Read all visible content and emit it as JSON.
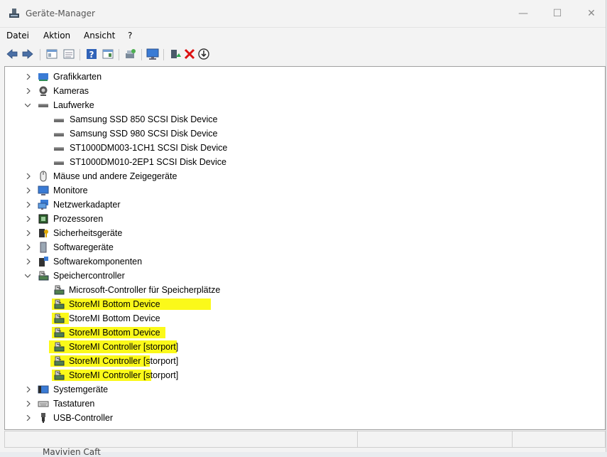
{
  "window": {
    "title": "Geräte-Manager",
    "controls": {
      "minimize": "—",
      "maximize": "☐",
      "close": "✕"
    }
  },
  "menu": [
    "Datei",
    "Aktion",
    "Ansicht",
    "?"
  ],
  "toolbar_icons": [
    "back-arrow-icon",
    "forward-arrow-icon",
    "show-hide-console-tree-icon",
    "properties-icon",
    "help-icon",
    "action-pane-icon",
    "scan-hardware-icon",
    "monitor-icon",
    "update-driver-icon",
    "uninstall-icon",
    "disable-device-icon"
  ],
  "tree": {
    "grafikkarten": "Grafikkarten",
    "kameras": "Kameras",
    "laufwerke": "Laufwerke",
    "laufwerke_children": [
      "Samsung SSD 850 SCSI Disk Device",
      "Samsung SSD 980 SCSI Disk Device",
      "ST1000DM003-1CH1 SCSI Disk Device",
      "ST1000DM010-2EP1 SCSI Disk Device"
    ],
    "maeuse": "Mäuse und andere Zeigegeräte",
    "monitore": "Monitore",
    "netzwerkadapter": "Netzwerkadapter",
    "prozessoren": "Prozessoren",
    "sicherheitsgeraete": "Sicherheitsgeräte",
    "softwaregeraete": "Softwaregeräte",
    "softwarekomponenten": "Softwarekomponenten",
    "speichercontroller": "Speichercontroller",
    "speichercontroller_children": [
      "Microsoft-Controller für Speicherplätze",
      "StoreMI Bottom Device",
      "StoreMI Bottom Device",
      "StoreMI Bottom Device",
      "StoreMI Controller [storport]",
      "StoreMI Controller [storport]",
      "StoreMI Controller [storport]"
    ],
    "systemgeraete": "Systemgeräte",
    "tastaturen": "Tastaturen",
    "usb_controller": "USB-Controller"
  },
  "highlight_color": "#fbf91a",
  "bottom_text": "Mavivien Caft"
}
